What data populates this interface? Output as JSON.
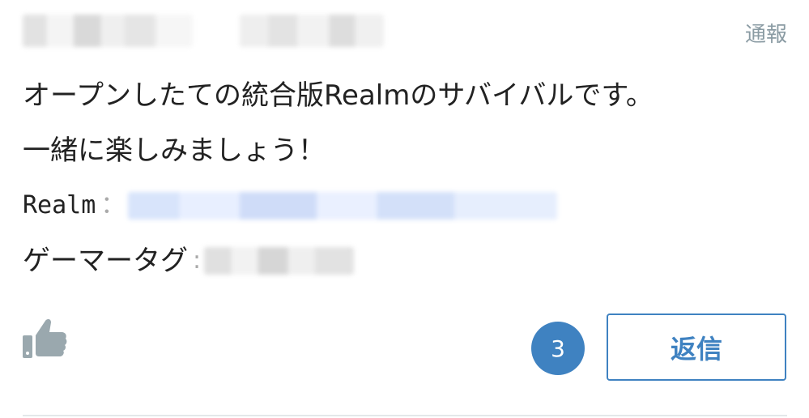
{
  "header": {
    "report_label": "通報"
  },
  "post": {
    "line1": "オープンしたての統合版Realmのサバイバルです。",
    "line2": "一緒に楽しみましょう！",
    "realm_label": "Realm",
    "realm_sep": "：",
    "gamertag_label": "ゲーマータグ",
    "gamertag_sep": ":"
  },
  "actions": {
    "like_icon": "thumbs-up-icon",
    "reply_count": "3",
    "reply_label": "返信"
  },
  "colors": {
    "accent": "#3f82c1",
    "muted": "#8a9ba3",
    "icon_gray": "#9aa8ae"
  }
}
